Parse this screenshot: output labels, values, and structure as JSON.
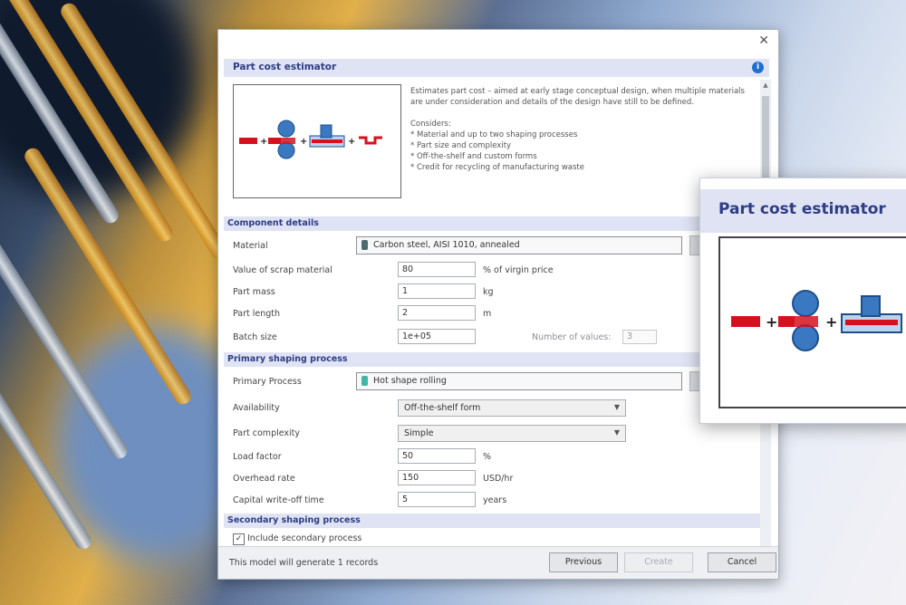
{
  "dialog": {
    "title": "Part cost estimator",
    "description": "Estimates part cost – aimed at early stage conceptual design, when multiple materials are under consideration and details of the design have still to be defined.",
    "considers_heading": "Considers:",
    "considers": [
      "* Material and up to two shaping processes",
      "* Part size and complexity",
      "* Off-the-shelf and custom forms",
      "* Credit for recycling of manufacturing waste"
    ],
    "sections": {
      "component": "Component details",
      "primary": "Primary shaping process",
      "secondary": "Secondary shaping process"
    },
    "component": {
      "material_label": "Material",
      "material_value": "Carbon steel, AISI 1010, annealed",
      "scrap_label": "Value of scrap material",
      "scrap_value": "80",
      "scrap_unit": "% of virgin price",
      "mass_label": "Part mass",
      "mass_value": "1",
      "mass_unit": "kg",
      "length_label": "Part length",
      "length_value": "2",
      "length_unit": "m",
      "batch_label": "Batch size",
      "batch_value": "1e+05",
      "num_values_label": "Number of values:",
      "num_values_value": "3"
    },
    "primary": {
      "process_label": "Primary Process",
      "process_value": "Hot shape rolling",
      "availability_label": "Availability",
      "availability_value": "Off-the-shelf form",
      "complexity_label": "Part complexity",
      "complexity_value": "Simple",
      "load_label": "Load factor",
      "load_value": "50",
      "load_unit": "%",
      "overhead_label": "Overhead rate",
      "overhead_value": "150",
      "overhead_unit": "USD/hr",
      "capital_label": "Capital write-off time",
      "capital_value": "5",
      "capital_unit": "years"
    },
    "secondary": {
      "include_label": "Include secondary process",
      "include_checked": true
    },
    "footer": {
      "status": "This model will generate 1 records",
      "previous": "Previous",
      "create": "Create",
      "cancel": "Cancel"
    },
    "colors": {
      "header_bg": "#dfe3f3",
      "header_text": "#2d3d86",
      "material_bar": "#d8101e",
      "roller": "#3a78c2"
    }
  },
  "zoom": {
    "title": "Part cost estimator"
  }
}
